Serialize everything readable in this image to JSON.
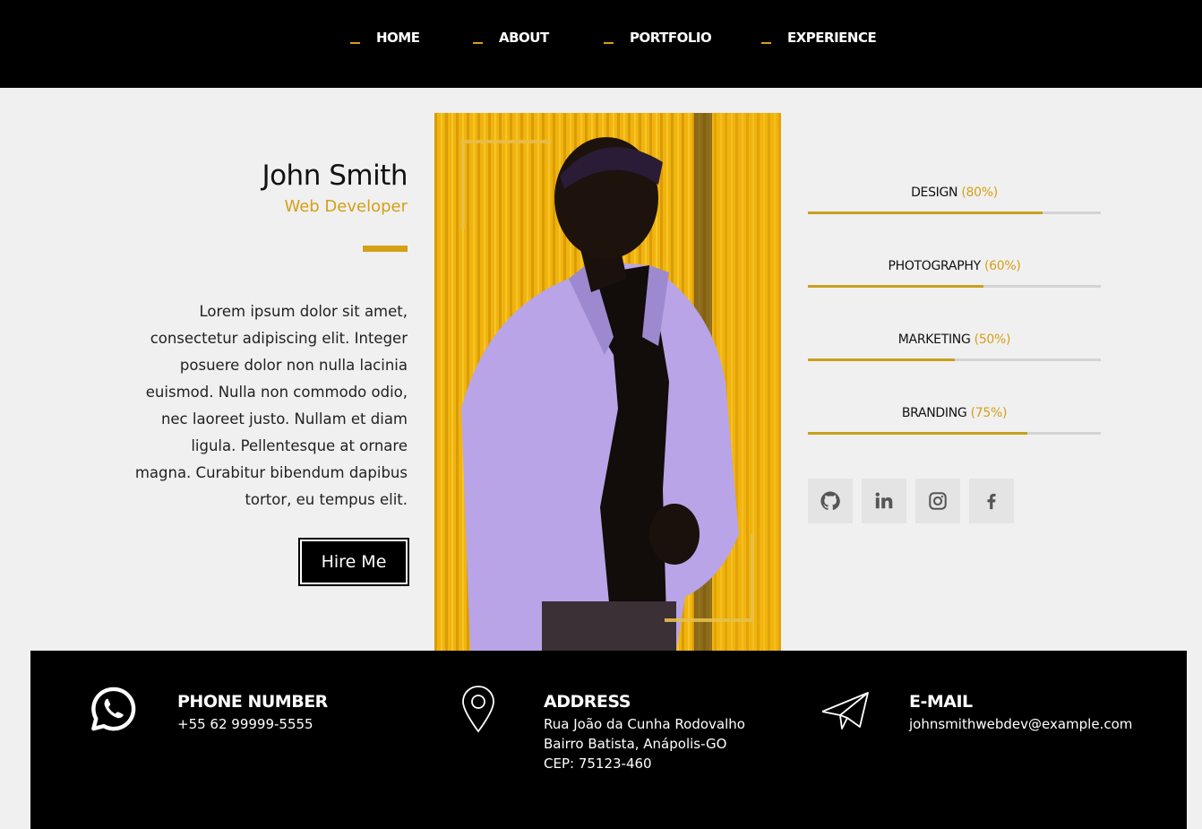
{
  "nav": {
    "items": [
      {
        "label": "HOME"
      },
      {
        "label": "ABOUT"
      },
      {
        "label": "PORTFOLIO"
      },
      {
        "label": "EXPERIENCE"
      }
    ]
  },
  "profile": {
    "name": "John Smith",
    "role": "Web Developer",
    "bio": "Lorem ipsum dolor sit amet, consectetur adipiscing elit. Integer posuere dolor non nulla lacinia euismod. Nulla non commodo odio, nec laoreet justo. Nullam et diam ligula. Pellentesque at ornare magna. Curabitur bibendum dapibus tortor, eu tempus elit.",
    "hire_label": "Hire Me"
  },
  "skills": [
    {
      "name": "DESIGN",
      "percent_label": "(80%)",
      "value": 0.8
    },
    {
      "name": "PHOTOGRAPHY",
      "percent_label": "(60%)",
      "value": 0.6
    },
    {
      "name": "MARKETING",
      "percent_label": "(50%)",
      "value": 0.5
    },
    {
      "name": "BRANDING",
      "percent_label": "(75%)",
      "value": 0.75
    }
  ],
  "social": {
    "icons": [
      "github-icon",
      "linkedin-icon",
      "instagram-icon",
      "facebook-icon"
    ]
  },
  "contact": {
    "phone": {
      "title": "PHONE NUMBER",
      "lines": [
        "+55 62 99999-5555"
      ],
      "icon": "whatsapp-icon"
    },
    "address": {
      "title": "ADDRESS",
      "lines": [
        "Rua João da Cunha Rodovalho",
        "Bairro Batista, Anápolis-GO",
        "CEP: 75123-460"
      ],
      "icon": "location-pin-icon"
    },
    "email": {
      "title": "E-MAIL",
      "lines": [
        "johnsmithwebdev@example.com"
      ],
      "icon": "paper-plane-icon"
    }
  },
  "colors": {
    "accent": "#d4a017",
    "nav_bg": "#000000",
    "page_bg": "#f0f0f0",
    "footer_bg": "#000000",
    "photo_bg": "#f1b40d",
    "shirt": "#b8a4e6"
  }
}
